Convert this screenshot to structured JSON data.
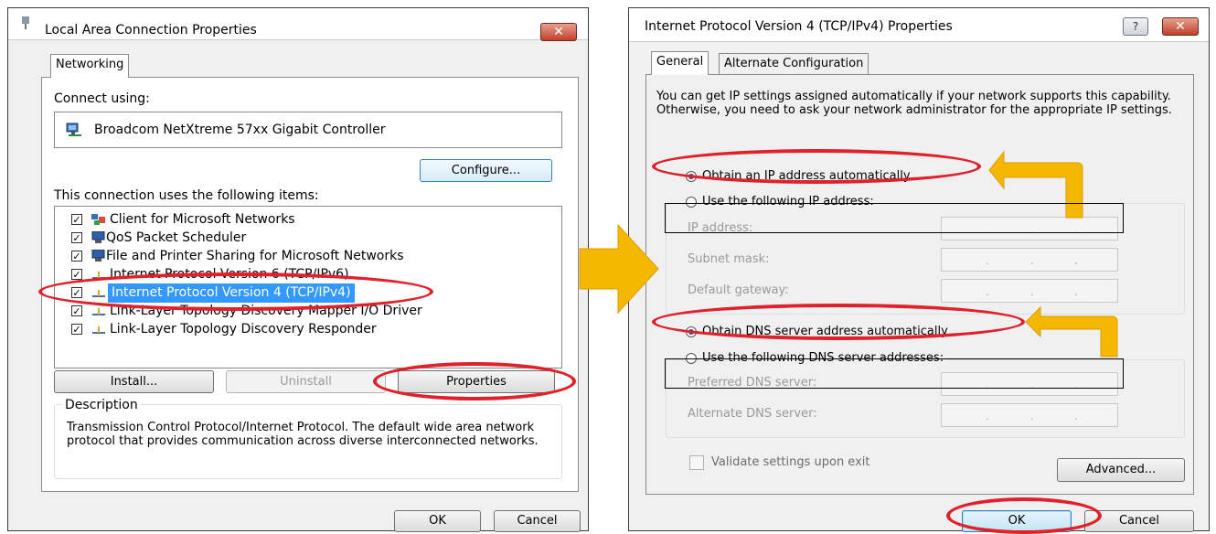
{
  "left_dialog": {
    "title": "Local Area Connection Properties",
    "close_label": "✕",
    "tab": "Networking",
    "connect_using_label": "Connect using:",
    "adapter_name": "Broadcom NetXtreme 57xx Gigabit Controller",
    "configure_label": "Configure...",
    "items_label": "This connection uses the following items:",
    "items": [
      {
        "label": "Client for Microsoft Networks",
        "checked": true
      },
      {
        "label": "QoS Packet Scheduler",
        "checked": true
      },
      {
        "label": "File and Printer Sharing for Microsoft Networks",
        "checked": true
      },
      {
        "label": "Internet Protocol Version 6 (TCP/IPv6)",
        "checked": true
      },
      {
        "label": "Internet Protocol Version 4 (TCP/IPv4)",
        "checked": true,
        "selected": true
      },
      {
        "label": "Link-Layer Topology Discovery Mapper I/O Driver",
        "checked": true
      },
      {
        "label": "Link-Layer Topology Discovery Responder",
        "checked": true
      }
    ],
    "install_label": "Install...",
    "uninstall_label": "Uninstall",
    "properties_label": "Properties",
    "description_legend": "Description",
    "description_text": "Transmission Control Protocol/Internet Protocol. The default wide area network protocol that provides communication across diverse interconnected networks.",
    "ok_label": "OK",
    "cancel_label": "Cancel"
  },
  "right_dialog": {
    "title": "Internet Protocol Version 4 (TCP/IPv4) Properties",
    "help_label": "?",
    "close_label": "✕",
    "tabs": [
      "General",
      "Alternate Configuration"
    ],
    "intro_text": "You can get IP settings assigned automatically if your network supports this capability. Otherwise, you need to ask your network administrator for the appropriate IP settings.",
    "radio_auto_ip": "Obtain an IP address automatically",
    "radio_manual_ip": "Use the following IP address:",
    "ip_address_label": "IP address:",
    "subnet_mask_label": "Subnet mask:",
    "default_gateway_label": "Default gateway:",
    "radio_auto_dns": "Obtain DNS server address automatically",
    "radio_manual_dns": "Use the following DNS server addresses:",
    "preferred_dns_label": "Preferred DNS server:",
    "alternate_dns_label": "Alternate DNS server:",
    "validate_label": "Validate settings upon exit",
    "advanced_label": "Advanced...",
    "ok_label": "OK",
    "cancel_label": "Cancel",
    "ip_dots": "."
  },
  "annotations": {
    "highlight_color": "#e0202a",
    "arrow_color": "#f5b800"
  }
}
